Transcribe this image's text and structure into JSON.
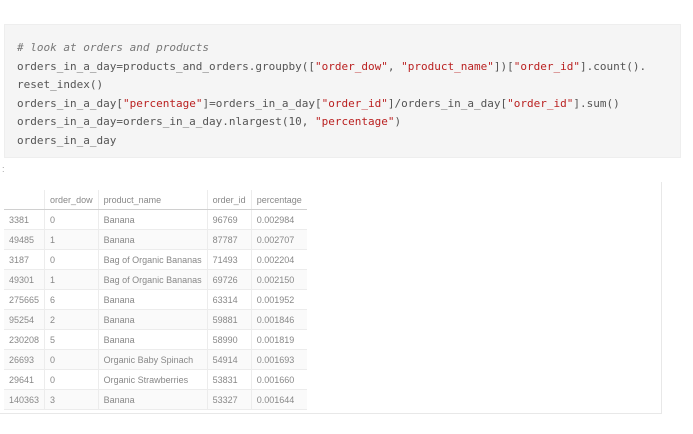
{
  "code": {
    "comment": "# look at orders and products",
    "line1": {
      "a": "orders_in_a_day=products_and_orders.groupby([",
      "s1": "\"order_dow\"",
      "b": ", ",
      "s2": "\"product_name\"",
      "c": "])[",
      "s3": "\"order_id\"",
      "d": "].count()."
    },
    "line2": "reset_index()",
    "line3": {
      "a": "orders_in_a_day[",
      "s1": "\"percentage\"",
      "b": "]=orders_in_a_day[",
      "s2": "\"order_id\"",
      "c": "]/orders_in_a_day[",
      "s3": "\"order_id\"",
      "d": "].sum()"
    },
    "line4": {
      "a": "orders_in_a_day=orders_in_a_day.nlargest(10, ",
      "s1": "\"percentage\"",
      "b": ")"
    },
    "line5": "orders_in_a_day"
  },
  "prompt": ":",
  "table": {
    "columns": [
      "",
      "order_dow",
      "product_name",
      "order_id",
      "percentage"
    ],
    "rows": [
      [
        "3381",
        "0",
        "Banana",
        "96769",
        "0.002984"
      ],
      [
        "49485",
        "1",
        "Banana",
        "87787",
        "0.002707"
      ],
      [
        "3187",
        "0",
        "Bag of Organic Bananas",
        "71493",
        "0.002204"
      ],
      [
        "49301",
        "1",
        "Bag of Organic Bananas",
        "69726",
        "0.002150"
      ],
      [
        "275665",
        "6",
        "Banana",
        "63314",
        "0.001952"
      ],
      [
        "95254",
        "2",
        "Banana",
        "59881",
        "0.001846"
      ],
      [
        "230208",
        "5",
        "Banana",
        "58990",
        "0.001819"
      ],
      [
        "26693",
        "0",
        "Organic Baby Spinach",
        "54914",
        "0.001693"
      ],
      [
        "29641",
        "0",
        "Organic Strawberries",
        "53831",
        "0.001660"
      ],
      [
        "140363",
        "3",
        "Banana",
        "53327",
        "0.001644"
      ]
    ]
  }
}
